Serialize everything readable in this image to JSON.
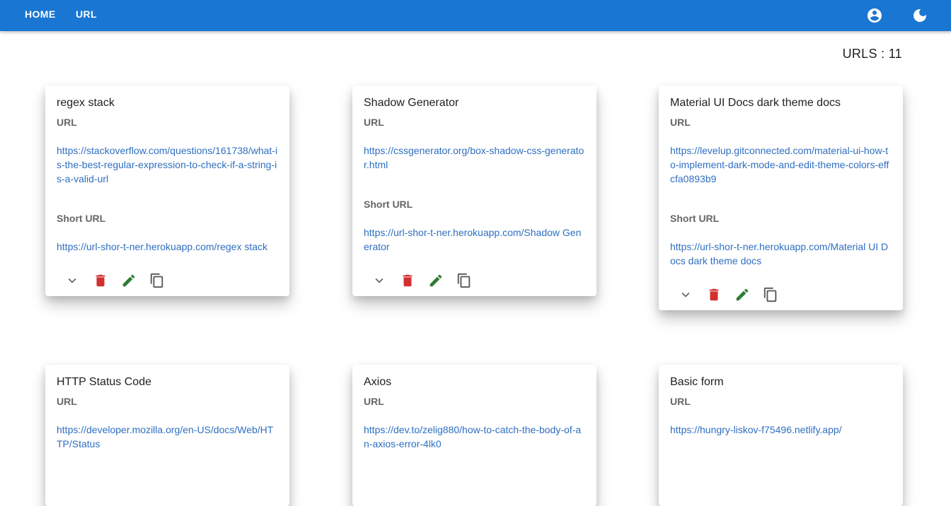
{
  "nav": {
    "home_label": "HOME",
    "url_label": "URL",
    "account_icon": "account-circle-icon",
    "theme_icon": "dark-mode-moon-icon"
  },
  "summary": {
    "label": "URLS : ",
    "count": "11"
  },
  "labels": {
    "url": "URL",
    "short_url": "Short URL"
  },
  "colors": {
    "appbar": "#1976d2",
    "link": "#2f6fc1",
    "delete": "#d32f2f",
    "edit": "#2e7d32"
  },
  "cards": [
    {
      "title": "regex stack",
      "url": "https://stackoverflow.com/questions/161738/what-is-the-best-regular-expression-to-check-if-a-string-is-a-valid-url",
      "short_url": "https://url-shor-t-ner.herokuapp.com/regex stack"
    },
    {
      "title": "Shadow Generator",
      "url": "https://cssgenerator.org/box-shadow-css-generator.html",
      "short_url": "https://url-shor-t-ner.herokuapp.com/Shadow Generator"
    },
    {
      "title": "Material UI Docs dark theme docs",
      "url": "https://levelup.gitconnected.com/material-ui-how-to-implement-dark-mode-and-edit-theme-colors-effcfa0893b9",
      "short_url": "https://url-shor-t-ner.herokuapp.com/Material UI Docs dark theme docs"
    },
    {
      "title": "HTTP Status Code",
      "url": "https://developer.mozilla.org/en-US/docs/Web/HTTP/Status",
      "short_url": ""
    },
    {
      "title": "Axios",
      "url": "https://dev.to/zelig880/how-to-catch-the-body-of-an-axios-error-4lk0",
      "short_url": ""
    },
    {
      "title": "Basic form",
      "url": "https://hungry-liskov-f75496.netlify.app/",
      "short_url": ""
    }
  ]
}
